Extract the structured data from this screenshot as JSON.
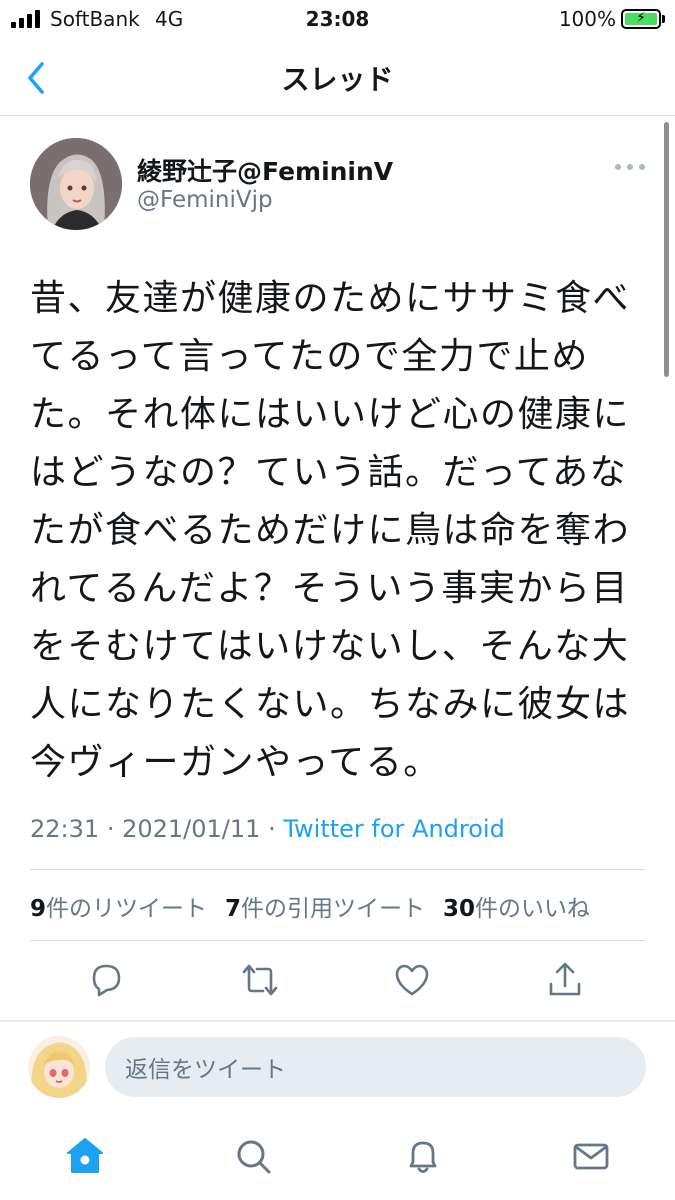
{
  "status_bar": {
    "carrier": "SoftBank",
    "network": "4G",
    "time": "23:08",
    "battery": "100%",
    "battery_level": 1.0
  },
  "header": {
    "title": "スレッド",
    "back_icon": "chevron-left-icon"
  },
  "tweet": {
    "display_name": "綾野辻子@FemininV",
    "handle": "@FeminiVjp",
    "text": "昔、友達が健康のためにササミ食べ\nてるって言ってたので全力で止め\nた。それ体にはいいけど心の健康に\nはどうなの？ていう話。だってあな\nたが食べるためだけに鳥は命を奪わ\nれてるんだよ？そういう事実から目\nをそむけてはいけないし、そんな大\n人になりたくない。ちなみに彼女は\n今ヴィーガンやってる。",
    "time": "22:31",
    "date": "2021/01/11",
    "separator": "·",
    "source": "Twitter for Android",
    "stats": {
      "retweets_count": "9",
      "retweets_label": "件のリツイート",
      "quotes_count": "7",
      "quotes_label": "件の引用ツイート",
      "likes_count": "30",
      "likes_label": "件のいいね"
    },
    "actions": [
      "reply-icon",
      "retweet-icon",
      "heart-icon",
      "share-icon"
    ]
  },
  "reply": {
    "placeholder": "返信をツイート"
  },
  "tab_bar": [
    "home-icon",
    "search-icon",
    "bell-icon",
    "mail-icon"
  ],
  "colors": {
    "accent": "#1da1f2",
    "secondary_text": "#657786",
    "battery_green": "#4cd964"
  }
}
